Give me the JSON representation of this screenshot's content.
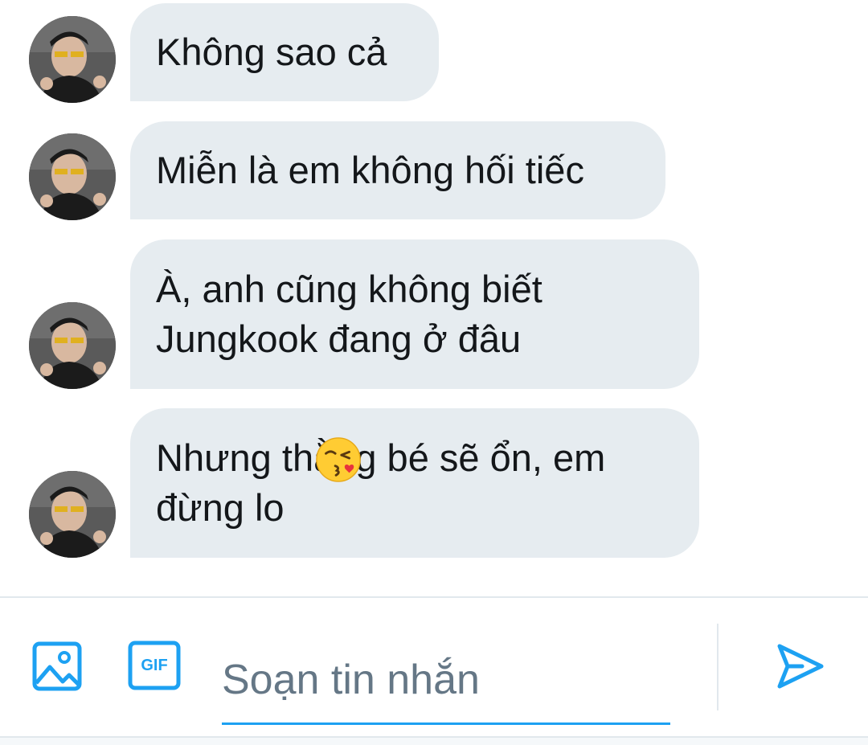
{
  "messages": [
    {
      "text": "Không sao cả",
      "avatar_icon": "user-avatar-photo"
    },
    {
      "text": "Miễn là em không hối tiếc",
      "avatar_icon": "user-avatar-photo"
    },
    {
      "text": "À, anh cũng không biết\nJungkook đang ở đâu",
      "avatar_icon": "user-avatar-photo"
    },
    {
      "text": "Nhưng thằng bé sẽ ổn, em\nđừng lo",
      "avatar_icon": "user-avatar-photo",
      "emoji": "face-blowing-a-kiss"
    }
  ],
  "composer": {
    "placeholder": "Soạn tin nhắn",
    "value": "",
    "image_icon": "image-icon",
    "gif_icon": "gif-icon",
    "gif_label": "GIF",
    "send_icon": "send-icon"
  },
  "colors": {
    "bubble": "#e6ecf0",
    "accent": "#1da1f2",
    "text": "#14171a",
    "placeholder": "#657786"
  }
}
